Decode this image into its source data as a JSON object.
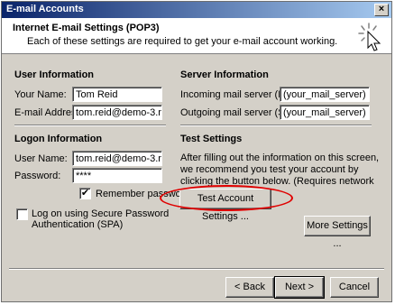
{
  "window": {
    "title": "E-mail Accounts",
    "close_glyph": "×"
  },
  "header": {
    "title": "Internet E-mail Settings (POP3)",
    "subtitle": "Each of these settings are required to get your e-mail account working."
  },
  "user_info": {
    "section_title": "User Information",
    "name_label": "Your Name:",
    "name_value": "Tom Reid",
    "email_label": "E-mail Address:",
    "email_value": "tom.reid@demo-3.net"
  },
  "server_info": {
    "section_title": "Server Information",
    "incoming_label": "Incoming mail server (POP3):",
    "incoming_value": "(your_mail_server)",
    "outgoing_label": "Outgoing mail server (SMTP):",
    "outgoing_value": "(your_mail_server)"
  },
  "logon_info": {
    "section_title": "Logon Information",
    "user_label": "User Name:",
    "user_value": "tom.reid@demo-3.net",
    "password_label": "Password:",
    "password_value": "****",
    "remember_label": "Remember password",
    "remember_checked": true,
    "spa_label_line1": "Log on using Secure Password",
    "spa_label_line2": "Authentication (SPA)",
    "spa_checked": false
  },
  "test_settings": {
    "section_title": "Test Settings",
    "description": "After filling out the information on this screen, we recommend you test your account by clicking the button below. (Requires network connection)",
    "test_button": "Test Account Settings ...",
    "highlight_color": "#e00000"
  },
  "buttons": {
    "more_settings": "More Settings ...",
    "back": "< Back",
    "next": "Next >",
    "cancel": "Cancel"
  },
  "icons": {
    "wizard": "wizard-cursor-icon",
    "check": "✔"
  }
}
